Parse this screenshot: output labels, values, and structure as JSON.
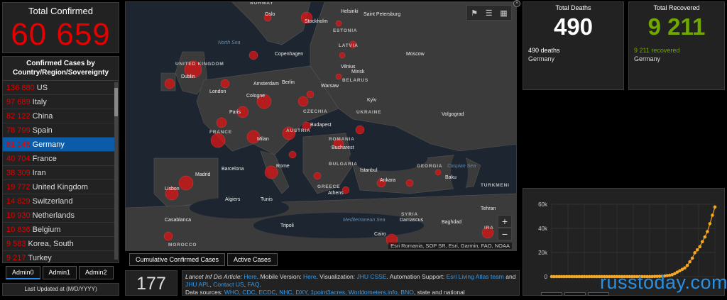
{
  "total_confirmed": {
    "label": "Total Confirmed",
    "value": "60 659"
  },
  "country_list": {
    "header": "Confirmed Cases by Country/Region/Sovereignty",
    "items": [
      {
        "count": "136 880",
        "name": "US"
      },
      {
        "count": "97 689",
        "name": "Italy"
      },
      {
        "count": "82 122",
        "name": "China"
      },
      {
        "count": "78 799",
        "name": "Spain"
      },
      {
        "count": "61 146",
        "name": "Germany",
        "selected": true
      },
      {
        "count": "40 704",
        "name": "France"
      },
      {
        "count": "38 309",
        "name": "Iran"
      },
      {
        "count": "19 772",
        "name": "United Kingdom"
      },
      {
        "count": "14 829",
        "name": "Switzerland"
      },
      {
        "count": "10 930",
        "name": "Netherlands"
      },
      {
        "count": "10 836",
        "name": "Belgium"
      },
      {
        "count": "9 583",
        "name": "Korea, South"
      },
      {
        "count": "9 217",
        "name": "Turkey"
      }
    ]
  },
  "admin_tabs": [
    "Admin0",
    "Admin1",
    "Admin2"
  ],
  "last_updated": {
    "label": "Last Updated at (M/D/YYYY)"
  },
  "map": {
    "labels": [
      "NORWAY",
      "Oslo",
      "Stockholm",
      "Helsinki",
      "Saint Petersburg",
      "ESTONIA",
      "LATVIA",
      "North Sea",
      "Copenhagen",
      "Moscow",
      "UNITED KINGDOM",
      "Dublin",
      "Amsterdam",
      "Berlin",
      "Warsaw",
      "Vilnius",
      "Minsk",
      "BELARUS",
      "London",
      "Cologne",
      "Paris",
      "CZECHIA",
      "UKRAINE",
      "Kyiv",
      "Volgograd",
      "FRANCE",
      "AUSTRIA",
      "Budapest",
      "Milan",
      "ROMANIA",
      "Bucharest",
      "Barcelona",
      "Rome",
      "BULGARIA",
      "Istanbul",
      "Madrid",
      "GEORGIA",
      "Baku",
      "Caspian Sea",
      "Ankara",
      "GREECE",
      "Athens",
      "TURKMENI",
      "Algiers",
      "Tunis",
      "Lisbon",
      "Tehran",
      "Casablanca",
      "Tripoli",
      "Mediterranean Sea",
      "SYRIA",
      "Damascus",
      "Baghdad",
      "IRA",
      "Cairo",
      "MOROCCO"
    ],
    "toolbar_icons": [
      "bookmark-icon",
      "list-icon",
      "grid-icon"
    ],
    "zoom_in": "+",
    "zoom_out": "−",
    "attribution": "Esri Romania, SOP SR, Esri, Garmin, FAO, NOAA",
    "close": "×"
  },
  "map_tabs": [
    "Cumulative Confirmed Cases",
    "Active Cases"
  ],
  "deaths": {
    "label": "Total Deaths",
    "value": "490",
    "detail": "490 deaths",
    "country": "Germany"
  },
  "recovered": {
    "label": "Total Recovered",
    "value": "9 211",
    "detail": "9 211 recovered",
    "country": "Germany"
  },
  "chart_data": {
    "type": "line",
    "title": "",
    "xlabel": "",
    "ylabel": "",
    "ylim": [
      0,
      60000
    ],
    "yticks": [
      "0",
      "20k",
      "40k",
      "60k"
    ],
    "series": [
      {
        "values": [
          0,
          0,
          0,
          0,
          0,
          0,
          0,
          0,
          0,
          0,
          0,
          0,
          0,
          0,
          0,
          0,
          0,
          0,
          0,
          0,
          0,
          0,
          0,
          0,
          0,
          0,
          0,
          0,
          0,
          0,
          0,
          0,
          0,
          0,
          0,
          0,
          0,
          0,
          0,
          0,
          0,
          100,
          150,
          200,
          300,
          500,
          800,
          1100,
          1600,
          2400,
          3700,
          4800,
          6000,
          7200,
          9300,
          12300,
          15300,
          19800,
          22200,
          24800,
          29000,
          32900,
          37300,
          43900,
          50900,
          57700
        ],
        "color": "#f5a623"
      }
    ]
  },
  "count_panel": {
    "value": "177"
  },
  "info": {
    "line1_prefix": "Lancet Inf Dis Article: ",
    "line1_here": "Here",
    "line1_mobile": ". Mobile Version: ",
    "line1_here2": "Here",
    "line1_viz": ". Visualization: ",
    "line1_jhu": "JHU CSSE",
    "line1_auto": ". Automation Support: ",
    "line1_esri": "Esri Living Atlas team",
    "line1_and": " and ",
    "line1_jhuapl": "JHU APL",
    "line1_contact": "Contact US",
    "line1_faq": "FAQ",
    "line2_prefix": "Data sources: ",
    "line2_sources": "WHO, CDC, ECDC, NHC, DXY, 1point3acres, Worldometers.info, BNO",
    "line2_suffix": ", state and national"
  },
  "watermark": "russtoday.com"
}
